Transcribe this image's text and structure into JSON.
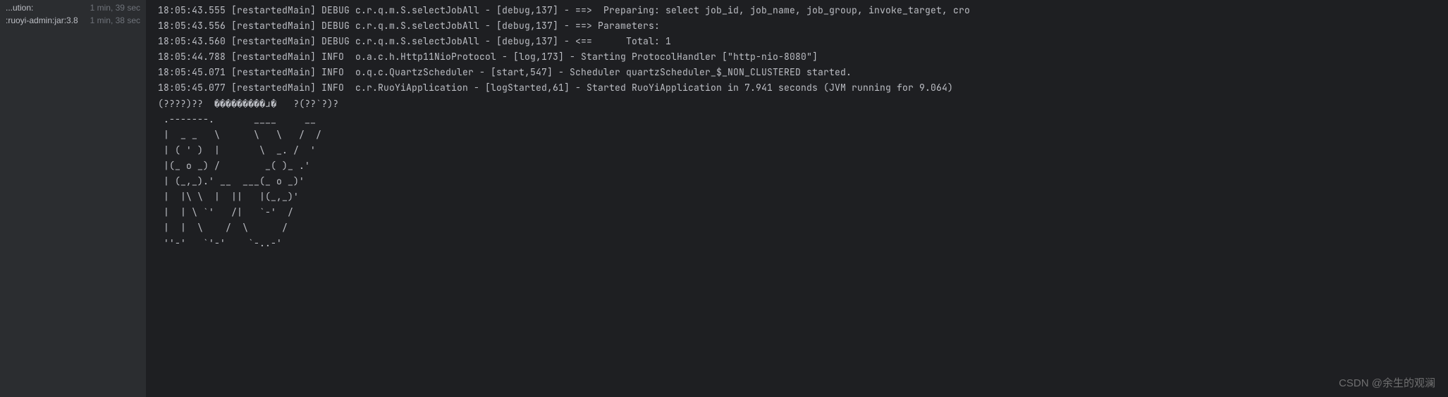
{
  "sidebar": {
    "items": [
      {
        "label": "...ution:",
        "time": "1 min, 39 sec"
      },
      {
        "label": ":ruoyi-admin:jar:3.8",
        "time": "1 min, 38 sec"
      }
    ]
  },
  "console": {
    "lines": [
      "18:05:43.555 [restartedMain] DEBUG c.r.q.m.S.selectJobAll - [debug,137] - ==>  Preparing: select job_id, job_name, job_group, invoke_target, cro",
      "18:05:43.556 [restartedMain] DEBUG c.r.q.m.S.selectJobAll - [debug,137] - ==> Parameters: ",
      "18:05:43.560 [restartedMain] DEBUG c.r.q.m.S.selectJobAll - [debug,137] - <==      Total: 1",
      "18:05:44.788 [restartedMain] INFO  o.a.c.h.Http11NioProtocol - [log,173] - Starting ProtocolHandler [\"http-nio-8080\"]",
      "18:05:45.071 [restartedMain] INFO  o.q.c.QuartzScheduler - [start,547] - Scheduler quartzScheduler_$_NON_CLUSTERED started.",
      "18:05:45.077 [restartedMain] INFO  c.r.RuoYiApplication - [logStarted,61] - Started RuoYiApplication in 7.941 seconds (JVM running for 9.064)",
      "(????)??  ���������ɹ�   ?(??`?)?"
    ],
    "ascii": " .-------.       ____     __        \n |  _ _   \\      \\   \\   /  /    \n | ( ' )  |       \\  _. /  '       \n |(_ o _) /        _( )_ .'         \n | (_,_).' __  ___(_ o _)'          \n |  |\\ \\  |  ||   |(_,_)'         \n |  | \\ `'   /|   `-'  /           \n |  |  \\    /  \\      /           \n ''-'   `'-'    `-..-'              "
  },
  "watermark": "CSDN @余生的观澜"
}
